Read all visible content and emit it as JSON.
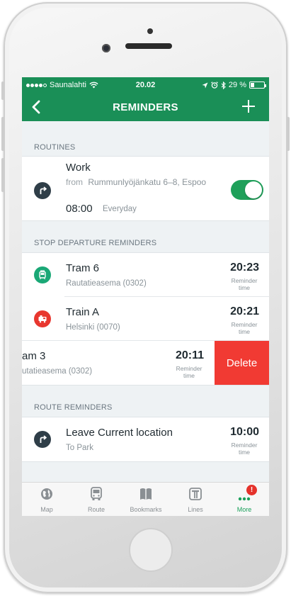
{
  "status_bar": {
    "carrier": "Saunalahti",
    "time": "20.02",
    "battery_percent": "29 %",
    "battery_level": 0.29
  },
  "nav": {
    "title": "REMINDERS",
    "back_icon": "chevron-left-icon",
    "add_icon": "plus-icon"
  },
  "routines": {
    "header": "ROUTINES",
    "items": [
      {
        "title": "Work",
        "from_label": "from",
        "from": "Rummunlyöjänkatu 6–8, Espoo",
        "time": "08:00",
        "repeat": "Everyday",
        "enabled": true,
        "icon": "route-turn-icon"
      }
    ]
  },
  "stop_departure": {
    "header": "STOP DEPARTURE REMINDERS",
    "items": [
      {
        "title": "Tram 6",
        "stop": "Rautatieasema (0302)",
        "time": "20:23",
        "time_label": "Reminder time",
        "icon": "tram-icon",
        "color": "#1aa876"
      },
      {
        "title": "Train A",
        "stop": "Helsinki (0070)",
        "time": "20:21",
        "time_label": "Reminder time",
        "icon": "train-icon",
        "color": "#e8372f"
      },
      {
        "title": "am 3",
        "stop": "utatieasema (0302)",
        "time": "20:11",
        "time_label": "Reminder time",
        "icon": "tram-icon",
        "color": "#1aa876",
        "swiped": true,
        "delete_label": "Delete"
      }
    ]
  },
  "route_reminders": {
    "header": "ROUTE REMINDERS",
    "items": [
      {
        "title": "Leave Current location",
        "destination": "To Park",
        "time": "10:00",
        "time_label": "Reminder time",
        "icon": "route-turn-icon"
      }
    ]
  },
  "tabbar": {
    "tabs": [
      {
        "label": "Map",
        "icon": "globe-icon",
        "active": false
      },
      {
        "label": "Route",
        "icon": "bus-icon",
        "active": false
      },
      {
        "label": "Bookmarks",
        "icon": "book-icon",
        "active": false
      },
      {
        "label": "Lines",
        "icon": "lines-icon",
        "active": false
      },
      {
        "label": "More",
        "icon": "more-dots-icon",
        "active": true,
        "badge": "!"
      }
    ]
  },
  "colors": {
    "brand_green": "#1a8f57",
    "active_tab": "#1aa05a",
    "delete_red": "#f13a33",
    "toggle_on": "#1fa05a"
  }
}
